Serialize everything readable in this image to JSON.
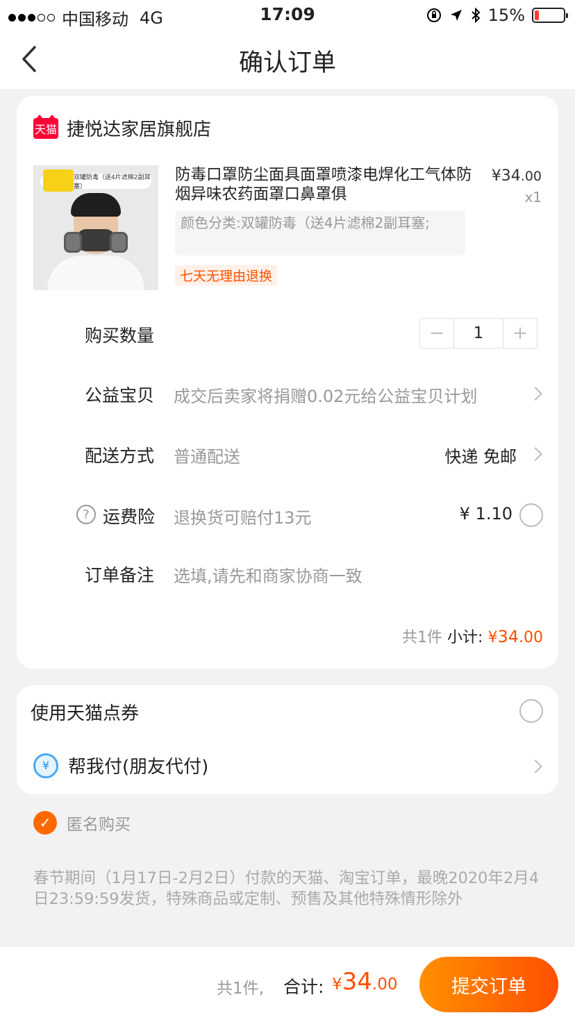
{
  "status_bar": {
    "carrier": "中国移动",
    "network": "4G",
    "time": "17:09",
    "battery": "15%"
  },
  "header": {
    "title": "确认订单"
  },
  "shop": {
    "logo_text": "天猫",
    "name": "捷悦达家居旗舰店"
  },
  "product": {
    "image_banner": "双罐防毒（送4片滤棉2副耳塞）",
    "title": "防毒口罩防尘面具面罩喷漆电焊化工气体防烟异味农药面罩口鼻罩俱",
    "price_int": "¥34",
    "price_dec": ".00",
    "qty": "x1",
    "sku": "颜色分类:双罐防毒（送4片滤棉2副耳塞;",
    "tag": "七天无理由退换"
  },
  "quantity": {
    "label": "购买数量",
    "minus": "−",
    "value": "1",
    "plus": "+"
  },
  "charity": {
    "label": "公益宝贝",
    "value": "成交后卖家将捐赠0.02元给公益宝贝计划"
  },
  "delivery": {
    "label": "配送方式",
    "value": "普通配送",
    "right": "快递 免邮"
  },
  "insurance": {
    "help": "?",
    "label": "运费险",
    "value": "退换货可赔付13元",
    "price": "¥ 1.10"
  },
  "remark": {
    "label": "订单备注",
    "placeholder": "选填,请先和商家协商一致"
  },
  "subtotal": {
    "count": "共1件",
    "label": "小计:",
    "currency": "¥",
    "int": "34",
    "dec": ".00"
  },
  "coupon": {
    "label": "使用天猫点券"
  },
  "friend_pay": {
    "icon": "¥",
    "label": "帮我付(朋友代付)"
  },
  "anonymous": {
    "check": "✓",
    "label": "匿名购买"
  },
  "notice": "春节期间（1月17日-2月2日）付款的天猫、淘宝订单，最晚2020年2月4日23:59:59发货，特殊商品或定制、预售及其他特殊情形除外",
  "footer": {
    "count": "共1件,",
    "label": "合计:",
    "currency": "¥",
    "int": "34",
    "dec": ".00",
    "submit": "提交订单"
  },
  "colors": {
    "accent": "#ff5000",
    "tmall_red": "#ff0036"
  }
}
